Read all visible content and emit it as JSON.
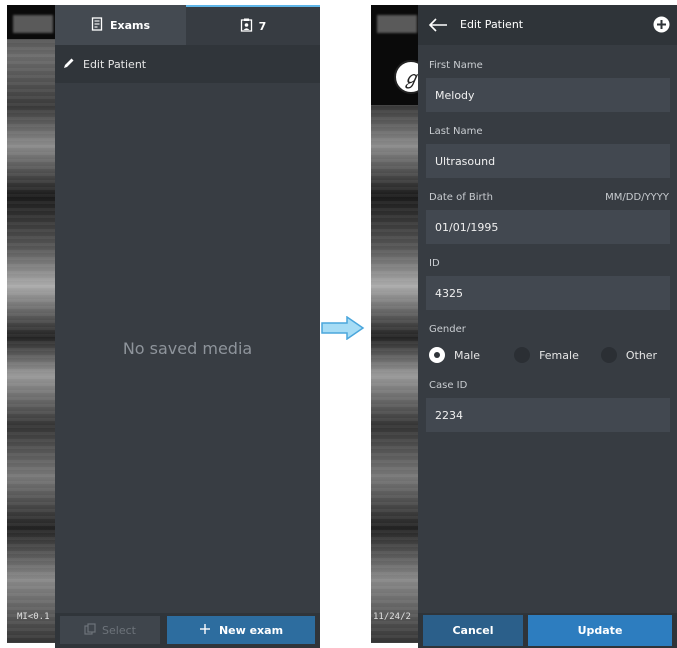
{
  "left_screen": {
    "tabs": [
      {
        "label": "Exams",
        "icon": "document-icon"
      },
      {
        "label": "7",
        "icon": "clipboard-user-icon"
      }
    ],
    "edit_patient_label": "Edit Patient",
    "empty_message": "No saved media",
    "select_label": "Select",
    "new_exam_label": "New exam",
    "mi_label": "MI<0.1"
  },
  "right_screen": {
    "title": "Edit Patient",
    "fields": {
      "first_name_label": "First Name",
      "first_name_value": "Melody",
      "last_name_label": "Last Name",
      "last_name_value": "Ultrasound",
      "dob_label": "Date of Birth",
      "dob_format": "MM/DD/YYYY",
      "dob_value": "01/01/1995",
      "id_label": "ID",
      "id_value": "4325",
      "gender_label": "Gender",
      "gender_options": [
        "Male",
        "Female",
        "Other"
      ],
      "case_id_label": "Case ID",
      "case_id_value": "2234"
    },
    "cancel_label": "Cancel",
    "update_label": "Update",
    "date_overlay": "11/24/2"
  },
  "colors": {
    "panel_bg": "#373c42",
    "field_bg": "#424850",
    "accent_blue": "#2d7dbf",
    "arrow_blue": "#5fb6e8"
  }
}
